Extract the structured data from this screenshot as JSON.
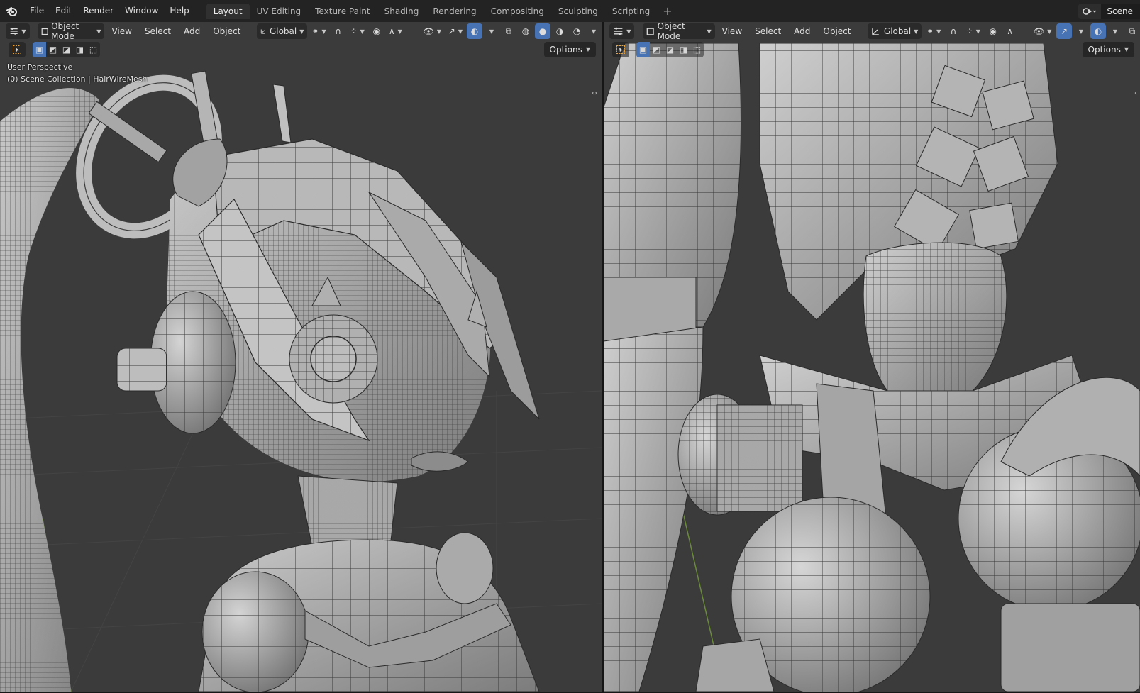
{
  "app": {
    "logo_icon": "blender-logo-icon"
  },
  "menu": [
    "File",
    "Edit",
    "Render",
    "Window",
    "Help"
  ],
  "workspaces": {
    "tabs": [
      "Layout",
      "UV Editing",
      "Texture Paint",
      "Shading",
      "Rendering",
      "Compositing",
      "Sculpting",
      "Scripting"
    ],
    "active": "Layout",
    "add_label": "+"
  },
  "scene": {
    "name": "Scene",
    "icon": "scene-icon"
  },
  "viewport_left": {
    "mode": "Object Mode",
    "menus": [
      "View",
      "Select",
      "Add",
      "Object"
    ],
    "orientation": "Global",
    "options_label": "Options",
    "perspective_text": "User Perspective",
    "collection_text": "(0) Scene Collection | HairWireMesh"
  },
  "viewport_right": {
    "mode": "Object Mode",
    "menus": [
      "View",
      "Select",
      "Add",
      "Object"
    ],
    "orientation": "Global",
    "options_label": "Options"
  },
  "colors": {
    "accent": "#4772b3",
    "topbar": "#232323",
    "viewport_bg": "#3b3b3b",
    "mesh_fill": "#9a9a9a",
    "wire": "#2a2a2a"
  }
}
